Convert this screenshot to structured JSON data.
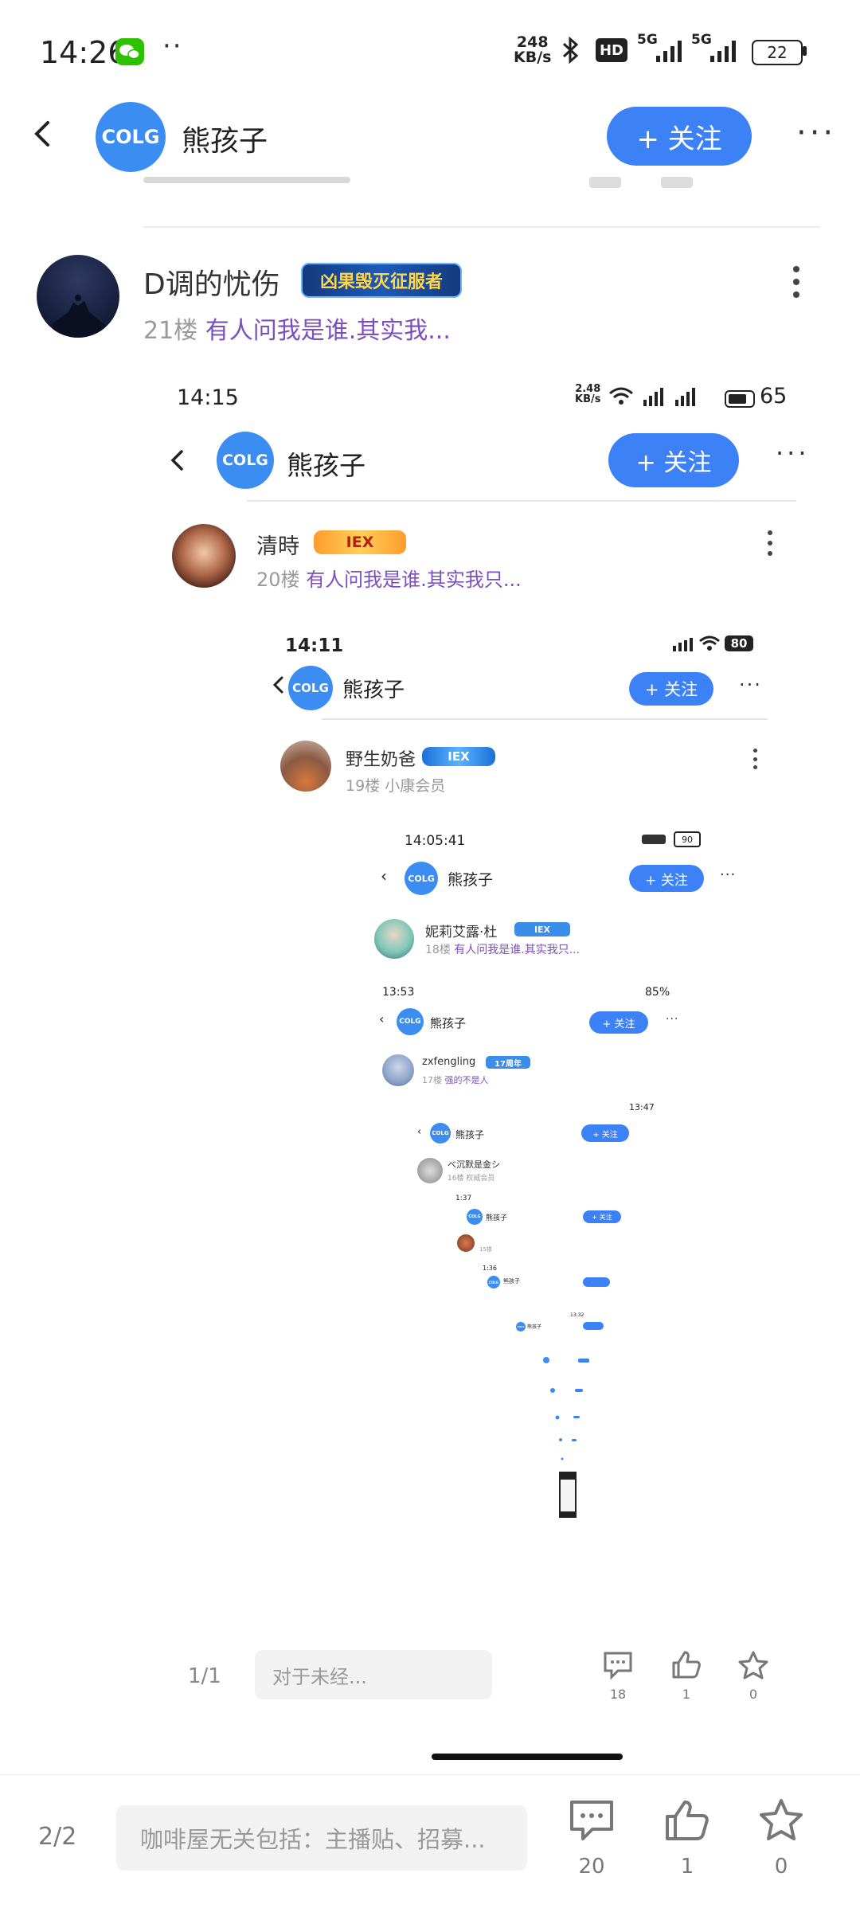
{
  "status_bar": {
    "time": "14:26",
    "net_speed_value": "248",
    "net_speed_unit": "KB/s",
    "hd": "HD",
    "signal_a": "5G",
    "signal_b": "5G",
    "battery": "22"
  },
  "header": {
    "logo_text": "COLG",
    "title": "熊孩子",
    "follow_label": "+ 关注"
  },
  "post": {
    "author": "D调的忧伤",
    "badge": "凶果毁灭征服者",
    "floor": "21楼",
    "subtitle": "有人问我是谁.其实我..."
  },
  "level1": {
    "time": "14:15",
    "net": "2.48",
    "net_unit": "KB/s",
    "battery": "65",
    "title": "熊孩子",
    "follow_label": "+ 关注",
    "author": "清時",
    "badge": "IEX",
    "floor": "20楼",
    "subtitle": "有人问我是谁.其实我只..."
  },
  "level2": {
    "time": "14:11",
    "battery": "80",
    "title": "熊孩子",
    "follow_label": "+ 关注",
    "author": "野生奶爸",
    "badge": "IEX",
    "floor": "19楼",
    "subtitle": "小康会员"
  },
  "level3": {
    "time": "14:05:41",
    "battery": "90",
    "title": "熊孩子",
    "follow_label": "+ 关注",
    "author": "妮莉艾露·杜",
    "badge": "IEX",
    "floor": "18楼",
    "subtitle": "有人问我是谁.其实我只..."
  },
  "level4": {
    "time": "13:53",
    "battery": "85%",
    "title": "熊孩子",
    "follow_label": "+ 关注",
    "author": "zxfengling",
    "badge": "17周年",
    "floor": "17楼",
    "subtitle": "强的不是人"
  },
  "level5": {
    "time": "13:47",
    "title": "熊孩子",
    "follow_label": "+ 关注",
    "author": "べ沉默是金シ",
    "floor": "16楼",
    "subtitle": "权威会员"
  },
  "level6": {
    "time": "1:37",
    "title": "熊孩子",
    "follow_label": "+ 关注",
    "floor": "15楼"
  },
  "level7": {
    "time": "1:36",
    "title": "熊孩子"
  },
  "level8": {
    "time": "13:32",
    "title": "熊孩子"
  },
  "inner_bar": {
    "page": "1/1",
    "placeholder": "对于未经...",
    "comments": "18",
    "likes": "1",
    "stars": "0"
  },
  "bottom_bar": {
    "page": "2/2",
    "placeholder": "咖啡屋无关包括：主播贴、招募...",
    "comments": "20",
    "likes": "1",
    "stars": "0"
  },
  "colors": {
    "accent": "#3c82f6",
    "purple_text": "#7b4fbf",
    "wechat_green": "#2dc100"
  }
}
